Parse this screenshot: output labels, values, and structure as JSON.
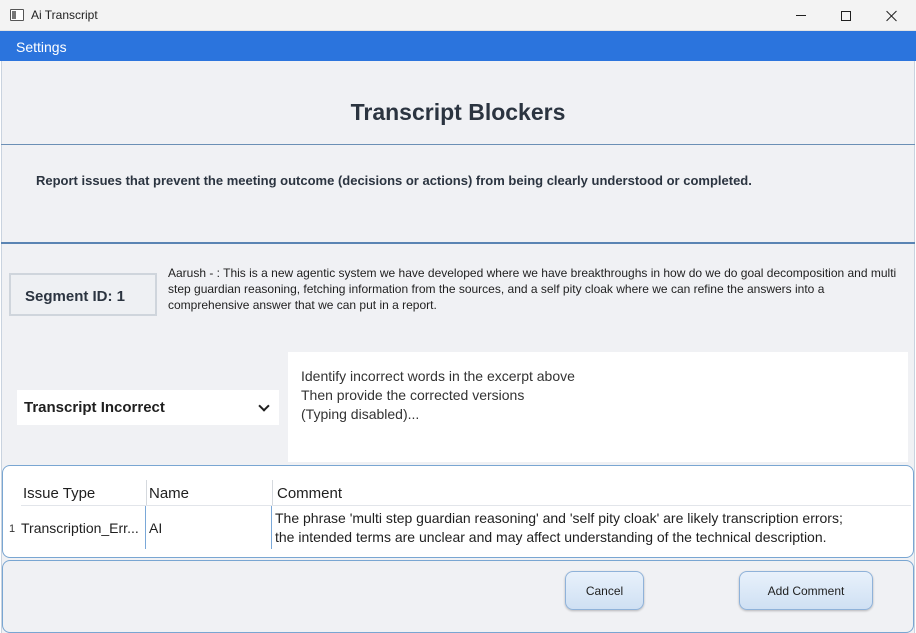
{
  "window": {
    "title": "Ai Transcript"
  },
  "menu": {
    "settings_label": "Settings"
  },
  "page": {
    "title": "Transcript Blockers",
    "description": "Report issues that prevent the meeting outcome (decisions or actions) from being clearly understood or completed."
  },
  "segment": {
    "id_label": "Segment ID: 1",
    "speaker": "Aarush",
    "text": "Aarush  - : This is a new agentic system we have developed where we have breakthroughs in how do we do goal decomposition and multi step guardian reasoning, fetching information from the sources, and a self pity cloak where we can refine the answers into a comprehensive answer that we can put in a report."
  },
  "issue_type_dropdown": {
    "selected": "Transcript Incorrect"
  },
  "instructions": {
    "line1": "Identify incorrect words in the excerpt above",
    "line2": "Then provide the corrected versions",
    "line3": "(Typing disabled)..."
  },
  "grid": {
    "columns": [
      "Issue Type",
      "Name",
      "Comment"
    ],
    "rows": [
      {
        "number": "1",
        "issue_type": "Transcription_Err...",
        "name": "AI",
        "comment_line1": "The phrase 'multi step guardian reasoning' and 'self pity cloak' are likely transcription errors;",
        "comment_line2": "the intended terms are unclear and may affect understanding of the technical description."
      }
    ]
  },
  "buttons": {
    "cancel": "Cancel",
    "add_comment": "Add Comment"
  },
  "colors": {
    "accent": "#2b74dd",
    "background": "#f0f1f4",
    "border": "#79a6d2"
  }
}
